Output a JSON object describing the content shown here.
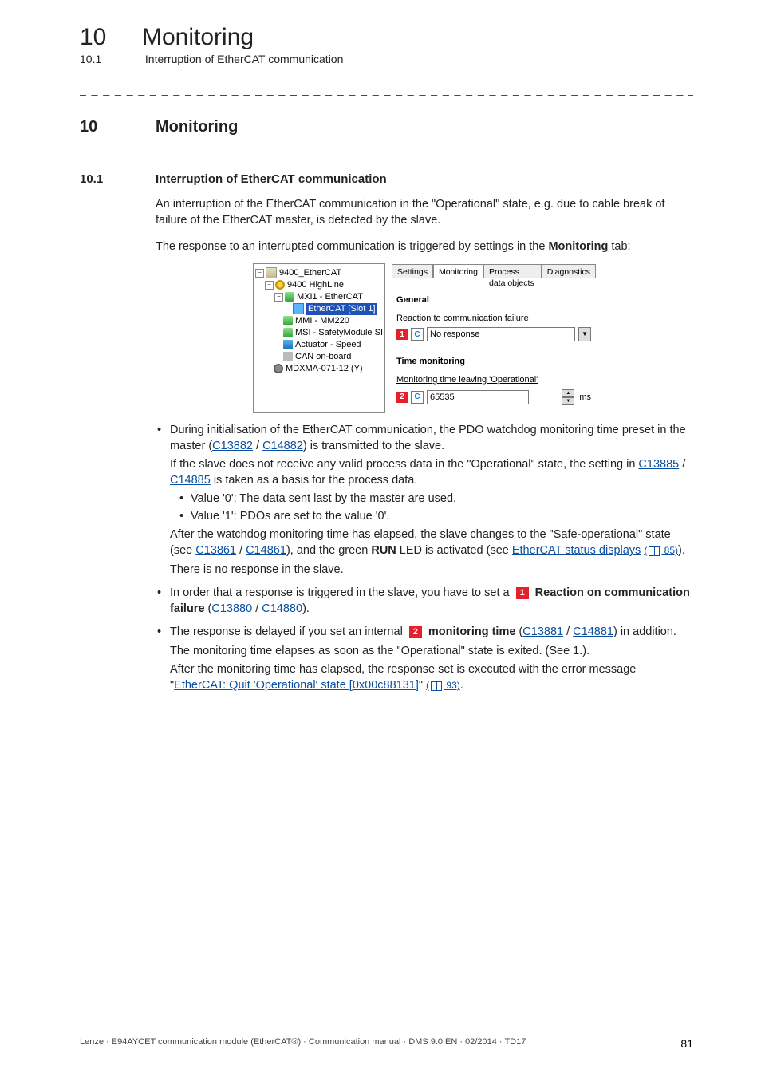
{
  "header": {
    "num": "10",
    "title": "Monitoring",
    "sub_num": "10.1",
    "sub_title": "Interruption of EtherCAT communication"
  },
  "section": {
    "h1_num": "10",
    "h1_title": "Monitoring",
    "h2_num": "10.1",
    "h2_title": "Interruption of EtherCAT communication"
  },
  "intro": {
    "p1": "An interruption of the EtherCAT communication in the \"Operational\" state, e.g. due to cable break of failure of the EtherCAT master, is detected by the slave.",
    "p2_a": "The response to an interrupted communication is triggered by settings in the ",
    "p2_b": "Monitoring",
    "p2_c": " tab:"
  },
  "shot": {
    "tree": {
      "n0": "9400_EtherCAT",
      "n1": "9400 HighLine",
      "n2": "MXI1 - EtherCAT",
      "n3": "EtherCAT [Slot 1]",
      "n4": "MMI - MM220",
      "n5": "MSI - SafetyModule SI",
      "n6": "Actuator - Speed",
      "n7": "CAN on-board",
      "n8": "MDXMA-071-12 (Y)"
    },
    "tabs": {
      "t1": "Settings",
      "t2": "Monitoring",
      "t3": "Process data objects",
      "t4": "Diagnostics"
    },
    "pane": {
      "general": "General",
      "react_label": "Reaction to communication failure",
      "marker1": "1",
      "c_label": "C",
      "react_value": "No response",
      "time_title": "Time monitoring",
      "time_label": "Monitoring time leaving 'Operational'",
      "marker2": "2",
      "time_value": "65535",
      "unit": "ms"
    }
  },
  "bullets": {
    "b1_a": "During initialisation of the EtherCAT communication, the PDO watchdog monitoring time preset in the master (",
    "b1_l1": "C13882",
    "b1_sep1": " / ",
    "b1_l2": "C14882",
    "b1_b": ") is transmitted to the slave.",
    "b1_p2a": "If the slave does not receive any valid process data in the \"Operational\" state, the setting in ",
    "b1_p2_l1": "C13885",
    "b1_p2_sep": " / ",
    "b1_p2_l2": "C14885",
    "b1_p2b": " is taken as a basis for the process data.",
    "b1_s1": "Value '0': The data sent last by the master are used.",
    "b1_s2": "Value '1': PDOs are set to the value '0'.",
    "b1_p3a": "After the watchdog monitoring time has elapsed, the slave changes to the \"Safe-operational\" state (see ",
    "b1_p3_l1": "C13861",
    "b1_p3_sep": " / ",
    "b1_p3_l2": "C14861",
    "b1_p3b": "), and the green ",
    "b1_p3_bold": "RUN",
    "b1_p3c": " LED is activated (see ",
    "b1_p3_l3": "EtherCAT status displays",
    "b1_p3_ref_open": "(",
    "b1_p3_refnum": " 85)",
    "b1_p3d": ").",
    "b1_p4a": "There is ",
    "b1_p4u": "no response in the slave",
    "b1_p4b": ".",
    "b2_a": "In order that a response is triggered in the slave, you have to set a ",
    "b2_marker": "1",
    "b2_bold": "Reaction on communication failure",
    "b2_b": " (",
    "b2_l1": "C13880",
    "b2_sep": " / ",
    "b2_l2": "C14880",
    "b2_c": ").",
    "b3_a": "The response is delayed if you set an internal ",
    "b3_marker": "2",
    "b3_bold": "monitoring time",
    "b3_b": " (",
    "b3_l1": "C13881",
    "b3_sep": " / ",
    "b3_l2": "C14881",
    "b3_c": ") in addition.",
    "b3_p2": "The monitoring time elapses as soon as the \"Operational\" state is exited. (See 1.).",
    "b3_p3a": "After the monitoring time has elapsed, the response set is executed with the error message \"",
    "b3_p3_l": "EtherCAT: Quit 'Operational' state [0x00c88131]",
    "b3_p3b": "\" ",
    "b3_ref_open": "(",
    "b3_p3_refnum": " 93)",
    "b3_p3c": "."
  },
  "footer": {
    "text": "Lenze · E94AYCET communication module (EtherCAT®) · Communication manual · DMS 9.0 EN · 02/2014 · TD17",
    "page": "81"
  }
}
